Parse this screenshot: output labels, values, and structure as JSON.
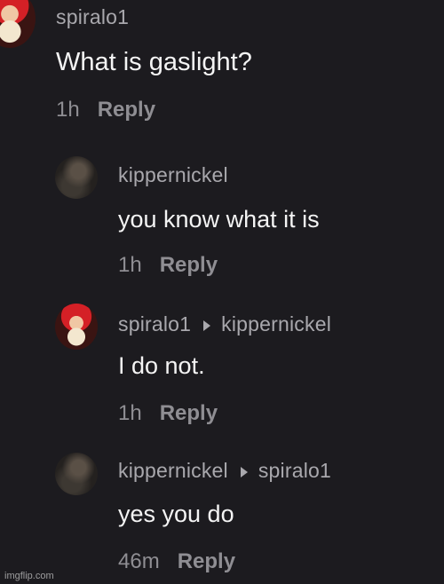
{
  "comments": [
    {
      "username": "spiralo1",
      "reply_to": "",
      "text": "What is gaslight?",
      "time": "1h",
      "reply_label": "Reply",
      "avatar": "red-hat-avatar"
    },
    {
      "username": "kippernickel",
      "reply_to": "",
      "text": "you know what it is",
      "time": "1h",
      "reply_label": "Reply",
      "avatar": "dark-photo-avatar"
    },
    {
      "username": "spiralo1",
      "reply_to": "kippernickel",
      "text": "I do not.",
      "time": "1h",
      "reply_label": "Reply",
      "avatar": "red-hat-avatar"
    },
    {
      "username": "kippernickel",
      "reply_to": "spiralo1",
      "text": "yes you do",
      "time": "46m",
      "reply_label": "Reply",
      "avatar": "dark-photo-avatar"
    }
  ],
  "watermark": "imgflip.com"
}
